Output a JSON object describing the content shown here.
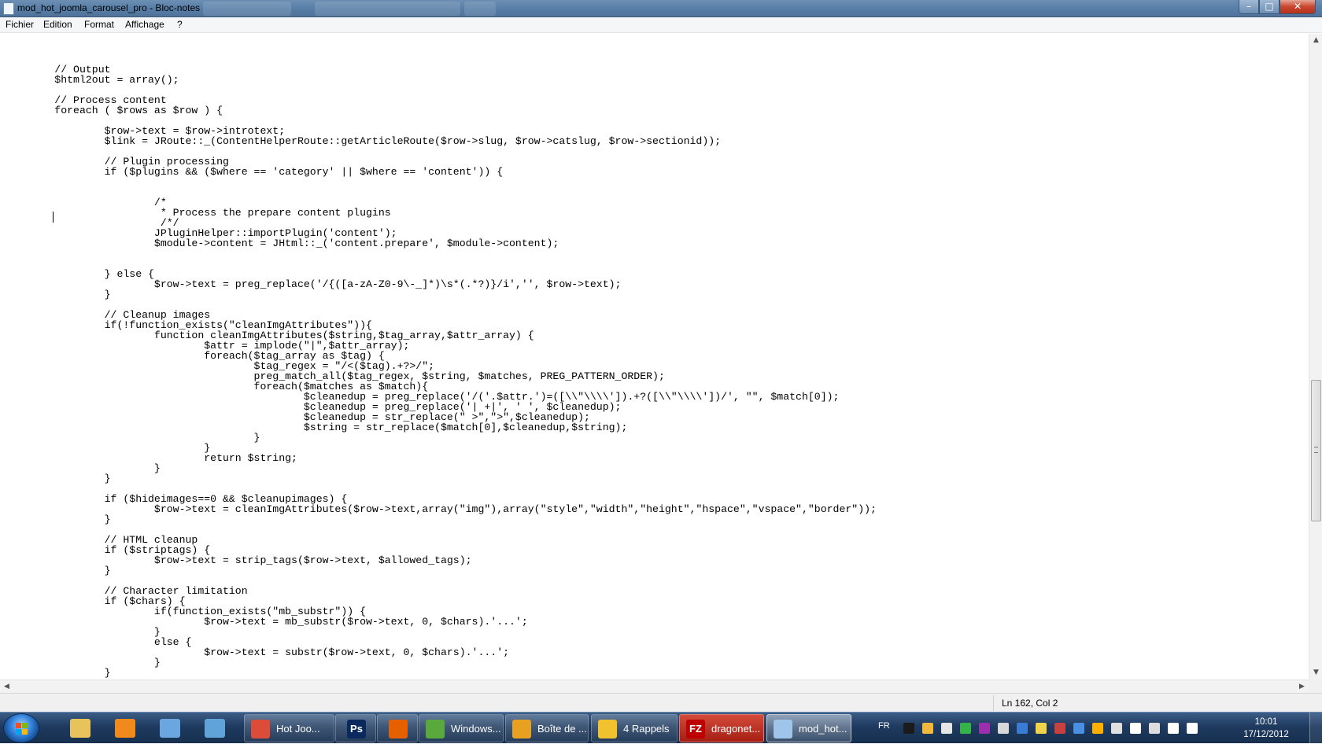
{
  "window": {
    "title": "mod_hot_joomla_carousel_pro - Bloc-notes",
    "controls": {
      "minimize": "–",
      "maximize": "□",
      "close": "✕"
    }
  },
  "menu": [
    "Fichier",
    "Edition",
    "Format",
    "Affichage",
    "?"
  ],
  "editor": {
    "lines": [
      "",
      "\t// Output",
      "\t$html2out = array();",
      "",
      "\t// Process content",
      "\tforeach ( $rows as $row ) {",
      "",
      "\t\t$row->text = $row->introtext;",
      "\t\t$link = JRoute::_(ContentHelperRoute::getArticleRoute($row->slug, $row->catslug, $row->sectionid));",
      "",
      "\t\t// Plugin processing",
      "\t\tif ($plugins && ($where == 'category' || $where == 'content')) {",
      "",
      "",
      "\t\t\t/*",
      "\t\t\t * Process the prepare content plugins",
      "\t\t\t /*/",
      "\t\t\tJPluginHelper::importPlugin('content');",
      "\t\t\t$module->content = JHtml::_('content.prepare', $module->content);",
      "",
      "",
      "\t\t} else {",
      "\t\t\t$row->text = preg_replace('/{([a-zA-Z0-9\\-_]*)\\s*(.*?)}/i','', $row->text);",
      "\t\t}",
      "",
      "\t\t// Cleanup images",
      "\t\tif(!function_exists(\"cleanImgAttributes\")){",
      "\t\t\tfunction cleanImgAttributes($string,$tag_array,$attr_array) {",
      "\t\t\t\t$attr = implode(\"|\",$attr_array);",
      "\t\t\t\tforeach($tag_array as $tag) {",
      "\t\t\t\t\t$tag_regex = \"/<($tag).+?>/\";",
      "\t\t\t\t\tpreg_match_all($tag_regex, $string, $matches, PREG_PATTERN_ORDER);",
      "\t\t\t\t\tforeach($matches as $match){",
      "\t\t\t\t\t\t$cleanedup = preg_replace('/('.$attr.')=([\\\\\"\\\\\\\\']).+?([\\\\\"\\\\\\\\'])/', \"\", $match[0]);",
      "\t\t\t\t\t\t$cleanedup = preg_replace('| +|', ' ', $cleanedup);",
      "\t\t\t\t\t\t$cleanedup = str_replace(\" >\",\">\",$cleanedup);",
      "\t\t\t\t\t\t$string = str_replace($match[0],$cleanedup,$string);",
      "\t\t\t\t\t}",
      "\t\t\t\t}",
      "\t\t\t\treturn $string;",
      "\t\t\t}",
      "\t\t}",
      "",
      "\t\tif ($hideimages==0 && $cleanupimages) {",
      "\t\t\t$row->text = cleanImgAttributes($row->text,array(\"img\"),array(\"style\",\"width\",\"height\",\"hspace\",\"vspace\",\"border\"));",
      "\t\t}",
      "",
      "\t\t// HTML cleanup",
      "\t\tif ($striptags) {",
      "\t\t\t$row->text = strip_tags($row->text, $allowed_tags);",
      "\t\t}",
      "",
      "\t\t// Character limitation",
      "\t\tif ($chars) {",
      "\t\t\tif(function_exists(\"mb_substr\")) {",
      "\t\t\t\t$row->text = mb_substr($row->text, 0, $chars).'...';",
      "\t\t\t}",
      "\t\t\telse {",
      "\t\t\t\t$row->text = substr($row->text, 0, $chars).'...';",
      "\t\t\t}",
      "\t\t}"
    ]
  },
  "status": {
    "position": "Ln 162, Col 2"
  },
  "taskbar": {
    "pinned": [
      {
        "name": "explorer-pinned-icon",
        "color": "#e8c25a"
      },
      {
        "name": "media-player-pinned-icon",
        "color": "#f08a1c"
      },
      {
        "name": "paint-pinned-icon",
        "color": "#6aa7e0"
      },
      {
        "name": "control-panel-pinned-icon",
        "color": "#5fa3d8"
      }
    ],
    "tasks": [
      {
        "name": "task-chrome",
        "label": "Hot Joo...",
        "icon": "chrome-icon",
        "color": "#dd4b39"
      },
      {
        "name": "task-photoshop",
        "label": "",
        "icon": "photoshop-icon",
        "color": "#0a2a5e",
        "glyph": "Ps"
      },
      {
        "name": "task-firefox",
        "label": "",
        "icon": "firefox-icon",
        "color": "#e66000"
      },
      {
        "name": "task-windows-live",
        "label": "Windows...",
        "icon": "messenger-icon",
        "color": "#5aa93c"
      },
      {
        "name": "task-outlook",
        "label": "Boîte de ...",
        "icon": "outlook-icon",
        "color": "#e8a020"
      },
      {
        "name": "task-reminders",
        "label": "4 Rappels",
        "icon": "bell-icon",
        "color": "#f2c12e"
      },
      {
        "name": "task-filezilla",
        "label": "dragonet...",
        "icon": "filezilla-icon",
        "color": "#bf0000",
        "glyph": "FZ"
      },
      {
        "name": "task-notepad",
        "label": "mod_hot...",
        "icon": "notepad-icon",
        "color": "#9fc6ea"
      }
    ],
    "tray": {
      "language": "FR",
      "icon_colors": [
        "#1b1b1b",
        "#f0b83c",
        "#e6e6e6",
        "#36b24a",
        "#9b2fae",
        "#d8d8d8",
        "#3a7bd5",
        "#f0d34a",
        "#c84040",
        "#4a90e2",
        "#ffb000",
        "#e0e0e0",
        "#ffffff",
        "#dddddd",
        "#ffffff",
        "#ffffff"
      ],
      "time": "10:01",
      "date": "17/12/2012"
    }
  }
}
